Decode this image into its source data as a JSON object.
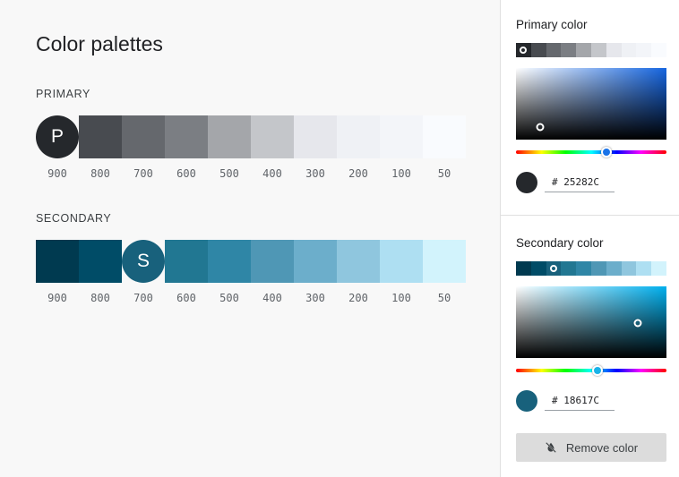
{
  "main": {
    "title": "Color palettes",
    "primary": {
      "label": "PRIMARY",
      "selected_letter": "P",
      "selected_index": 0,
      "swatches": [
        "#25282C",
        "#484B50",
        "#65686D",
        "#7B7E83",
        "#A4A6AA",
        "#C4C6CA",
        "#E6E7EC",
        "#EFF1F5",
        "#F3F5F9",
        "#F9FBFE"
      ],
      "shades": [
        "900",
        "800",
        "700",
        "600",
        "500",
        "400",
        "300",
        "200",
        "100",
        "50"
      ]
    },
    "secondary": {
      "label": "SECONDARY",
      "selected_letter": "S",
      "selected_index": 2,
      "swatches": [
        "#003A50",
        "#004C67",
        "#18617C",
        "#217792",
        "#2F86A6",
        "#4F97B5",
        "#6CAECB",
        "#8FC6DE",
        "#AEDFF2",
        "#D2F3FC"
      ],
      "shades": [
        "900",
        "800",
        "700",
        "600",
        "500",
        "400",
        "300",
        "200",
        "100",
        "50"
      ]
    }
  },
  "sidebar": {
    "primary": {
      "title": "Primary color",
      "strip": [
        "#25282C",
        "#484B50",
        "#65686D",
        "#7B7E83",
        "#A4A6AA",
        "#C4C6CA",
        "#E6E7EC",
        "#EFF1F5",
        "#F3F5F9",
        "#F9FBFE"
      ],
      "strip_selected": 0,
      "hue_color": "#1565e0",
      "hue_position": 0.6,
      "hue_handle_color": "#1a73e8",
      "saturation": 0.16,
      "brightness": 0.17,
      "current_color": "#25282C",
      "hex_value": "# 25282C"
    },
    "secondary": {
      "title": "Secondary color",
      "strip": [
        "#003A50",
        "#004C67",
        "#18617C",
        "#217792",
        "#2F86A6",
        "#4F97B5",
        "#6CAECB",
        "#8FC6DE",
        "#AEDFF2",
        "#D2F3FC"
      ],
      "strip_selected": 2,
      "hue_color": "#00b0ee",
      "hue_position": 0.54,
      "hue_handle_color": "#1ab2e8",
      "saturation": 0.81,
      "brightness": 0.49,
      "current_color": "#18617C",
      "hex_value": "# 18617C"
    },
    "remove_button_label": "Remove color",
    "remove_icon": "color-off-icon"
  }
}
